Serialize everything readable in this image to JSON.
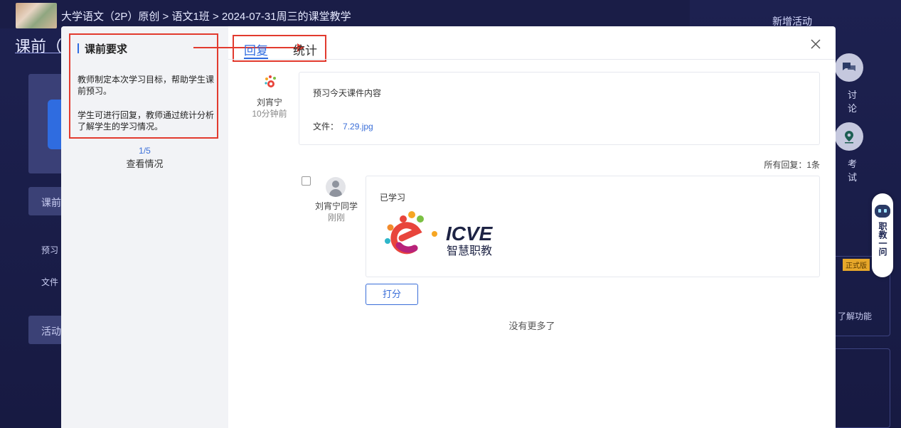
{
  "header": {
    "breadcrumb": "大学语文（2P）原创 > 语文1班 > 2024-07-31周三的课堂教学",
    "new_activity": "新增活动"
  },
  "background": {
    "stage_title": "课前（",
    "btn_before": "课前",
    "item_preview": "预习",
    "item_file": "文件",
    "btn_activity": "活动"
  },
  "right_tools": {
    "discussion": "讨论",
    "exam": "考试",
    "promo_tag": "正式版",
    "promo_text": "了解功能",
    "zhijiao_label": "职教一问"
  },
  "modal": {
    "requirements": {
      "title": "课前要求",
      "para1": "教师制定本次学习目标，帮助学生课前预习。",
      "para2": "学生可进行回复，教师通过统计分析了解学生的学习情况。"
    },
    "pager": "1/5",
    "view_status": "查看情况",
    "tabs": [
      {
        "label": "回复",
        "active": true
      },
      {
        "label": "统计",
        "active": false
      }
    ],
    "teacher_post": {
      "author": "刘宵宁",
      "time": "10分钟前",
      "text": "预习今天课件内容",
      "file_label": "文件：",
      "file_name": "7.29.jpg"
    },
    "reply_count": "所有回复：1条",
    "reply": {
      "author": "刘宵宁同学",
      "time": "刚刚",
      "text": "已学习",
      "image_logo_text": "ICVE",
      "image_logo_sub": "智慧职教"
    },
    "score_button": "打分",
    "no_more": "没有更多了"
  },
  "colors": {
    "accent": "#2f6ce0",
    "highlight": "#e23a2e",
    "background": "#1c1f4a"
  }
}
